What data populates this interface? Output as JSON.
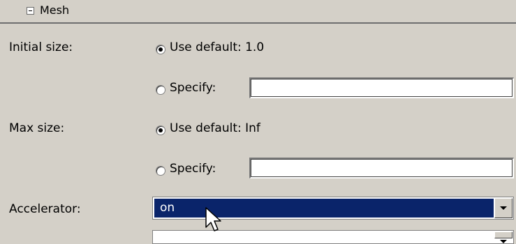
{
  "section": {
    "title": "Mesh"
  },
  "initial_size": {
    "label": "Initial size:",
    "default_option": "Use default: 1.0",
    "specify_option": "Specify:",
    "specify_value": "",
    "selected": "default"
  },
  "max_size": {
    "label": "Max size:",
    "default_option": "Use default: Inf",
    "specify_option": "Specify:",
    "specify_value": "",
    "selected": "default"
  },
  "accelerator": {
    "label": "Accelerator:",
    "value": "on"
  },
  "colors": {
    "panel_bg": "#d4d0c8",
    "selection_bg": "#0a246a",
    "selection_text": "#ffffff"
  }
}
